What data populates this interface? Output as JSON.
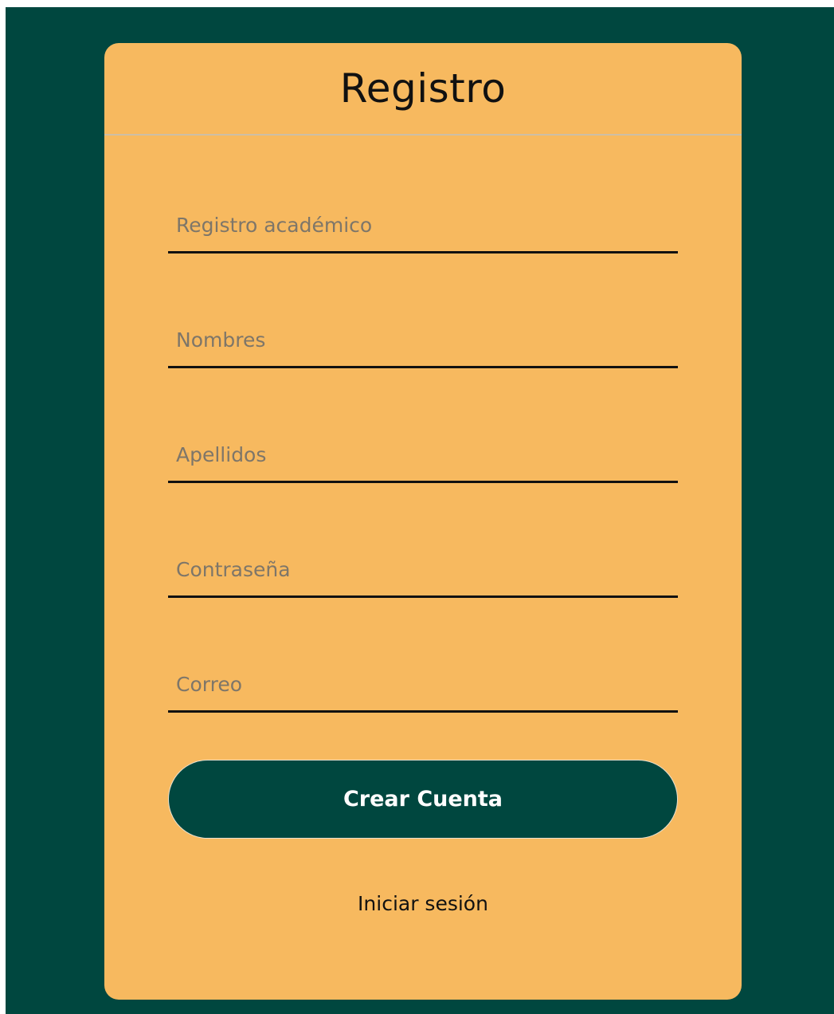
{
  "page": {
    "background_color": "#00473f",
    "card_color": "#f7b95f"
  },
  "form": {
    "title": "Registro",
    "fields": [
      {
        "placeholder": "Registro académico",
        "value": ""
      },
      {
        "placeholder": "Nombres",
        "value": ""
      },
      {
        "placeholder": "Apellidos",
        "value": ""
      },
      {
        "placeholder": "Contraseña",
        "value": ""
      },
      {
        "placeholder": "Correo",
        "value": ""
      }
    ],
    "submit_label": "Crear Cuenta",
    "login_link_label": "Iniciar sesión"
  }
}
